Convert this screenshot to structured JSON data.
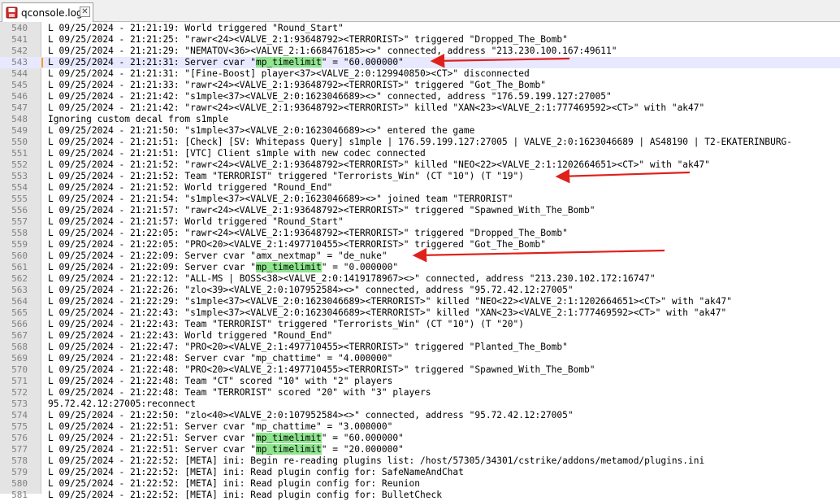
{
  "tab": {
    "title": "qconsole.log",
    "close_glyph": "✕"
  },
  "colors": {
    "highlight": "#8fe68f",
    "arrow": "#e0201b",
    "gutter": "#e4e4e4",
    "current_line": "#e8e8ff"
  },
  "editor": {
    "current_line": 543,
    "lines": [
      {
        "n": "540",
        "parts": [
          {
            "t": "L 09/25/2024 - 21:21:19: World triggered \"Round_Start\""
          }
        ]
      },
      {
        "n": "541",
        "parts": [
          {
            "t": "L 09/25/2024 - 21:21:25: \"rawr<24><VALVE_2:1:93648792><TERRORIST>\" triggered \"Dropped_The_Bomb\""
          }
        ]
      },
      {
        "n": "542",
        "parts": [
          {
            "t": "L 09/25/2024 - 21:21:29: \"NEMATOV<36><VALVE_2:1:668476185><>\" connected, address \"213.230.100.167:49611\""
          }
        ]
      },
      {
        "n": "543",
        "parts": [
          {
            "t": "L 09/25/2024 - 21:21:31: Server cvar \""
          },
          {
            "t": "mp_timelimit",
            "hl": true
          },
          {
            "t": "\" = \"60.000000\""
          }
        ]
      },
      {
        "n": "544",
        "parts": [
          {
            "t": "L 09/25/2024 - 21:21:31: \"[Fine-Boost] player<37><VALVE_2:0:129940850><CT>\" disconnected"
          }
        ]
      },
      {
        "n": "545",
        "parts": [
          {
            "t": "L 09/25/2024 - 21:21:33: \"rawr<24><VALVE_2:1:93648792><TERRORIST>\" triggered \"Got_The_Bomb\""
          }
        ]
      },
      {
        "n": "546",
        "parts": [
          {
            "t": "L 09/25/2024 - 21:21:42: \"s1mple<37><VALVE_2:0:1623046689><>\" connected, address \"176.59.199.127:27005\""
          }
        ]
      },
      {
        "n": "547",
        "parts": [
          {
            "t": "L 09/25/2024 - 21:21:42: \"rawr<24><VALVE_2:1:93648792><TERRORIST>\" killed \"XAN<23><VALVE_2:1:777469592><CT>\" with \"ak47\""
          }
        ]
      },
      {
        "n": "548",
        "parts": [
          {
            "t": "Ignoring custom decal from s1mple"
          }
        ]
      },
      {
        "n": "549",
        "parts": [
          {
            "t": "L 09/25/2024 - 21:21:50: \"s1mple<37><VALVE_2:0:1623046689><>\" entered the game"
          }
        ]
      },
      {
        "n": "550",
        "parts": [
          {
            "t": "L 09/25/2024 - 21:21:51: [Check] [SV: Whitepass Query] s1mple | 176.59.199.127:27005 | VALVE_2:0:1623046689 | AS48190 | T2-EKATERINBURG-"
          }
        ]
      },
      {
        "n": "551",
        "parts": [
          {
            "t": "L 09/25/2024 - 21:21:51: [VTC] Client s1mple with new codec connected"
          }
        ]
      },
      {
        "n": "552",
        "parts": [
          {
            "t": "L 09/25/2024 - 21:21:52: \"rawr<24><VALVE_2:1:93648792><TERRORIST>\" killed \"NEO<22><VALVE_2:1:1202664651><CT>\" with \"ak47\""
          }
        ]
      },
      {
        "n": "553",
        "parts": [
          {
            "t": "L 09/25/2024 - 21:21:52: Team \"TERRORIST\" triggered \"Terrorists_Win\" (CT \"10\") (T \"19\")"
          }
        ]
      },
      {
        "n": "554",
        "parts": [
          {
            "t": "L 09/25/2024 - 21:21:52: World triggered \"Round_End\""
          }
        ]
      },
      {
        "n": "555",
        "parts": [
          {
            "t": "L 09/25/2024 - 21:21:54: \"s1mple<37><VALVE_2:0:1623046689><>\" joined team \"TERRORIST\""
          }
        ]
      },
      {
        "n": "556",
        "parts": [
          {
            "t": "L 09/25/2024 - 21:21:57: \"rawr<24><VALVE_2:1:93648792><TERRORIST>\" triggered \"Spawned_With_The_Bomb\""
          }
        ]
      },
      {
        "n": "557",
        "parts": [
          {
            "t": "L 09/25/2024 - 21:21:57: World triggered \"Round_Start\""
          }
        ]
      },
      {
        "n": "558",
        "parts": [
          {
            "t": "L 09/25/2024 - 21:22:05: \"rawr<24><VALVE_2:1:93648792><TERRORIST>\" triggered \"Dropped_The_Bomb\""
          }
        ]
      },
      {
        "n": "559",
        "parts": [
          {
            "t": "L 09/25/2024 - 21:22:05: \"PRO<20><VALVE_2:1:497710455><TERRORIST>\" triggered \"Got_The_Bomb\""
          }
        ]
      },
      {
        "n": "560",
        "parts": [
          {
            "t": "L 09/25/2024 - 21:22:09: Server cvar \"amx_nextmap\" = \"de_nuke\""
          }
        ]
      },
      {
        "n": "561",
        "parts": [
          {
            "t": "L 09/25/2024 - 21:22:09: Server cvar \""
          },
          {
            "t": "mp_timelimit",
            "hl": true
          },
          {
            "t": "\" = \"0.000000\""
          }
        ]
      },
      {
        "n": "562",
        "parts": [
          {
            "t": "L 09/25/2024 - 21:22:12: \"ALL-MS | BOSS<38><VALVE_2:0:1419178967><>\" connected, address \"213.230.102.172:16747\""
          }
        ]
      },
      {
        "n": "563",
        "parts": [
          {
            "t": "L 09/25/2024 - 21:22:26: \"zlo<39><VALVE_2:0:107952584><>\" connected, address \"95.72.42.12:27005\""
          }
        ]
      },
      {
        "n": "564",
        "parts": [
          {
            "t": "L 09/25/2024 - 21:22:29: \"s1mple<37><VALVE_2:0:1623046689><TERRORIST>\" killed \"NEO<22><VALVE_2:1:1202664651><CT>\" with \"ak47\""
          }
        ]
      },
      {
        "n": "565",
        "parts": [
          {
            "t": "L 09/25/2024 - 21:22:43: \"s1mple<37><VALVE_2:0:1623046689><TERRORIST>\" killed \"XAN<23><VALVE_2:1:777469592><CT>\" with \"ak47\""
          }
        ]
      },
      {
        "n": "566",
        "parts": [
          {
            "t": "L 09/25/2024 - 21:22:43: Team \"TERRORIST\" triggered \"Terrorists_Win\" (CT \"10\") (T \"20\")"
          }
        ]
      },
      {
        "n": "567",
        "parts": [
          {
            "t": "L 09/25/2024 - 21:22:43: World triggered \"Round_End\""
          }
        ]
      },
      {
        "n": "568",
        "parts": [
          {
            "t": "L 09/25/2024 - 21:22:47: \"PRO<20><VALVE_2:1:497710455><TERRORIST>\" triggered \"Planted_The_Bomb\""
          }
        ]
      },
      {
        "n": "569",
        "parts": [
          {
            "t": "L 09/25/2024 - 21:22:48: Server cvar \"mp_chattime\" = \"4.000000\""
          }
        ]
      },
      {
        "n": "570",
        "parts": [
          {
            "t": "L 09/25/2024 - 21:22:48: \"PRO<20><VALVE_2:1:497710455><TERRORIST>\" triggered \"Spawned_With_The_Bomb\""
          }
        ]
      },
      {
        "n": "571",
        "parts": [
          {
            "t": "L 09/25/2024 - 21:22:48: Team \"CT\" scored \"10\" with \"2\" players"
          }
        ]
      },
      {
        "n": "572",
        "parts": [
          {
            "t": "L 09/25/2024 - 21:22:48: Team \"TERRORIST\" scored \"20\" with \"3\" players"
          }
        ]
      },
      {
        "n": "573",
        "parts": [
          {
            "t": "95.72.42.12:27005:reconnect"
          }
        ]
      },
      {
        "n": "574",
        "parts": [
          {
            "t": "L 09/25/2024 - 21:22:50: \"zlo<40><VALVE_2:0:107952584><>\" connected, address \"95.72.42.12:27005\""
          }
        ]
      },
      {
        "n": "575",
        "parts": [
          {
            "t": "L 09/25/2024 - 21:22:51: Server cvar \"mp_chattime\" = \"3.000000\""
          }
        ]
      },
      {
        "n": "576",
        "parts": [
          {
            "t": "L 09/25/2024 - 21:22:51: Server cvar \""
          },
          {
            "t": "mp_timelimit",
            "hl": true
          },
          {
            "t": "\" = \"60.000000\""
          }
        ]
      },
      {
        "n": "577",
        "parts": [
          {
            "t": "L 09/25/2024 - 21:22:51: Server cvar \""
          },
          {
            "t": "mp_timelimit",
            "hl": true
          },
          {
            "t": "\" = \"20.000000\""
          }
        ]
      },
      {
        "n": "578",
        "parts": [
          {
            "t": "L 09/25/2024 - 21:22:52: [META] ini: Begin re-reading plugins list: /host/57305/34301/cstrike/addons/metamod/plugins.ini"
          }
        ]
      },
      {
        "n": "579",
        "parts": [
          {
            "t": "L 09/25/2024 - 21:22:52: [META] ini: Read plugin config for: SafeNameAndChat"
          }
        ]
      },
      {
        "n": "580",
        "parts": [
          {
            "t": "L 09/25/2024 - 21:22:52: [META] ini: Read plugin config for: Reunion"
          }
        ]
      },
      {
        "n": "581",
        "parts": [
          {
            "t": "L 09/25/2024 - 21:22:52: [META] ini: Read plugin config for: BulletCheck"
          }
        ]
      }
    ]
  }
}
